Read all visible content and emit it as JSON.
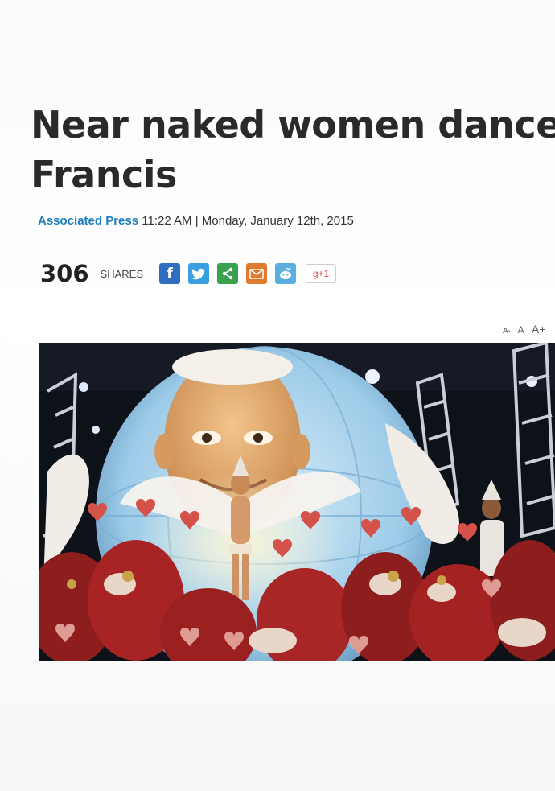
{
  "article": {
    "headline": "Near naked women dance Francis",
    "byline": {
      "source": "Associated Press",
      "time": "11:22 AM",
      "separator": "|",
      "date": "Monday, January 12th, 2015"
    }
  },
  "share_bar": {
    "count": "306",
    "label": "SHARES",
    "buttons": [
      {
        "icon": "facebook-icon",
        "glyph": "f"
      },
      {
        "icon": "twitter-icon"
      },
      {
        "icon": "share-icon"
      },
      {
        "icon": "email-icon"
      },
      {
        "icon": "reddit-icon"
      },
      {
        "icon": "google-plus-icon",
        "label": "g+1"
      }
    ]
  },
  "font_controls": {
    "decrease": "A-",
    "normal": "A",
    "increase": "A+"
  },
  "colors": {
    "headline": "#2a2a2a",
    "source_link": "#1a7fbd",
    "facebook": "#2f6dc0",
    "twitter": "#3a9fe0",
    "share": "#3aa24f",
    "email": "#e07a2e",
    "reddit": "#5aaee0"
  }
}
